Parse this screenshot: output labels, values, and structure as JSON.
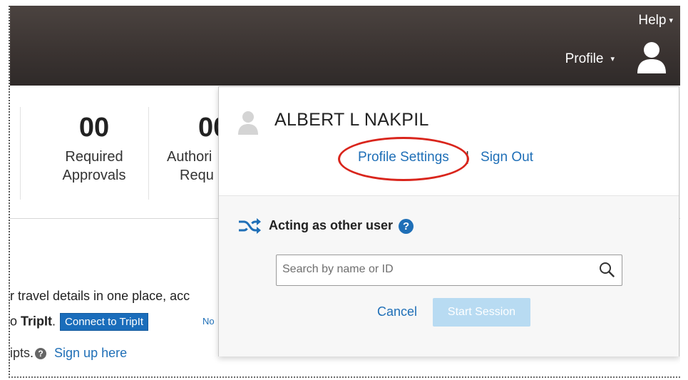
{
  "header": {
    "help_label": "Help",
    "profile_label": "Profile",
    "caret": "▾",
    "avatar_icon": "user-avatar-icon"
  },
  "stats": [
    {
      "value": "00",
      "label_line1": "Required",
      "label_line2": "Approvals"
    },
    {
      "value": "00",
      "label_line1": "Authori",
      "label_line2": "Requ"
    }
  ],
  "content": {
    "travel_text": "r travel details in one place, acc",
    "tripit_prefix": "o ",
    "tripit_bold": "TripIt",
    "tripit_suffix": ".",
    "connect_button": "Connect to TripIt",
    "no_text": "No",
    "receipts_text": "ipts.",
    "receipts_help": "?",
    "signup_link": "Sign up here"
  },
  "profile_menu": {
    "user_name": "ALBERT L NAKPIL",
    "profile_settings_label": "Profile Settings",
    "separator": "|",
    "sign_out_label": "Sign Out",
    "acting_label": "Acting as other user",
    "acting_help": "?",
    "search_placeholder": "Search by name or ID",
    "search_value": "",
    "cancel_label": "Cancel",
    "start_session_label": "Start Session"
  },
  "colors": {
    "link": "#1f6fb7",
    "header_bg": "#3a3331",
    "highlight_circle": "#d9251c",
    "start_disabled": "#b8dbf2"
  }
}
